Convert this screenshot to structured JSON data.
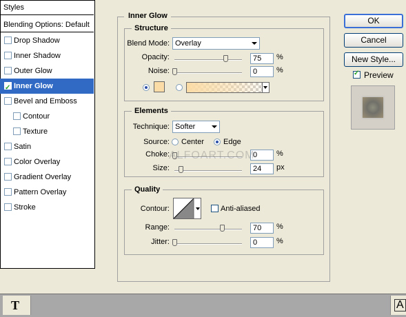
{
  "section_title": "Inner Glow",
  "styles_list": {
    "header": "Styles",
    "blending": "Blending Options: Default",
    "items": [
      {
        "label": "Drop Shadow",
        "checked": false,
        "indent": false
      },
      {
        "label": "Inner Shadow",
        "checked": false,
        "indent": false
      },
      {
        "label": "Outer Glow",
        "checked": false,
        "indent": false
      },
      {
        "label": "Inner Glow",
        "checked": true,
        "indent": false,
        "selected": true
      },
      {
        "label": "Bevel and Emboss",
        "checked": false,
        "indent": false
      },
      {
        "label": "Contour",
        "checked": false,
        "indent": true
      },
      {
        "label": "Texture",
        "checked": false,
        "indent": true
      },
      {
        "label": "Satin",
        "checked": false,
        "indent": false
      },
      {
        "label": "Color Overlay",
        "checked": false,
        "indent": false
      },
      {
        "label": "Gradient Overlay",
        "checked": false,
        "indent": false
      },
      {
        "label": "Pattern Overlay",
        "checked": false,
        "indent": false
      },
      {
        "label": "Stroke",
        "checked": false,
        "indent": false
      }
    ]
  },
  "structure": {
    "title": "Structure",
    "blend_mode_label": "Blend Mode:",
    "blend_mode_value": "Overlay",
    "opacity_label": "Opacity:",
    "opacity_value": "75",
    "opacity_unit": "%",
    "opacity_level": 0.75,
    "noise_label": "Noise:",
    "noise_value": "0",
    "noise_unit": "%",
    "noise_level": 0.0,
    "glow_color": "#FBDCA6",
    "gradient_start": "#FBDCA6",
    "color_mode_selected": "solid"
  },
  "elements": {
    "title": "Elements",
    "technique_label": "Technique:",
    "technique_value": "Softer",
    "source_label": "Source:",
    "source_center": "Center",
    "source_edge": "Edge",
    "source_selected": "edge",
    "choke_label": "Choke:",
    "choke_value": "0",
    "choke_unit": "%",
    "choke_level": 0.0,
    "size_label": "Size:",
    "size_value": "24",
    "size_unit": "px",
    "size_level": 0.096
  },
  "quality": {
    "title": "Quality",
    "contour_label": "Contour:",
    "anti_aliased_label": "Anti-aliased",
    "anti_aliased": false,
    "range_label": "Range:",
    "range_value": "70",
    "range_unit": "%",
    "range_level": 0.7,
    "jitter_label": "Jitter:",
    "jitter_value": "0",
    "jitter_unit": "%",
    "jitter_level": 0.0
  },
  "buttons": {
    "ok": "OK",
    "cancel": "Cancel",
    "new_style": "New Style...",
    "preview_label": "Preview",
    "preview_checked": true
  },
  "watermark": "ALFOART.COM",
  "taskbar": {
    "left_tool": "T",
    "right_tool": "A"
  }
}
